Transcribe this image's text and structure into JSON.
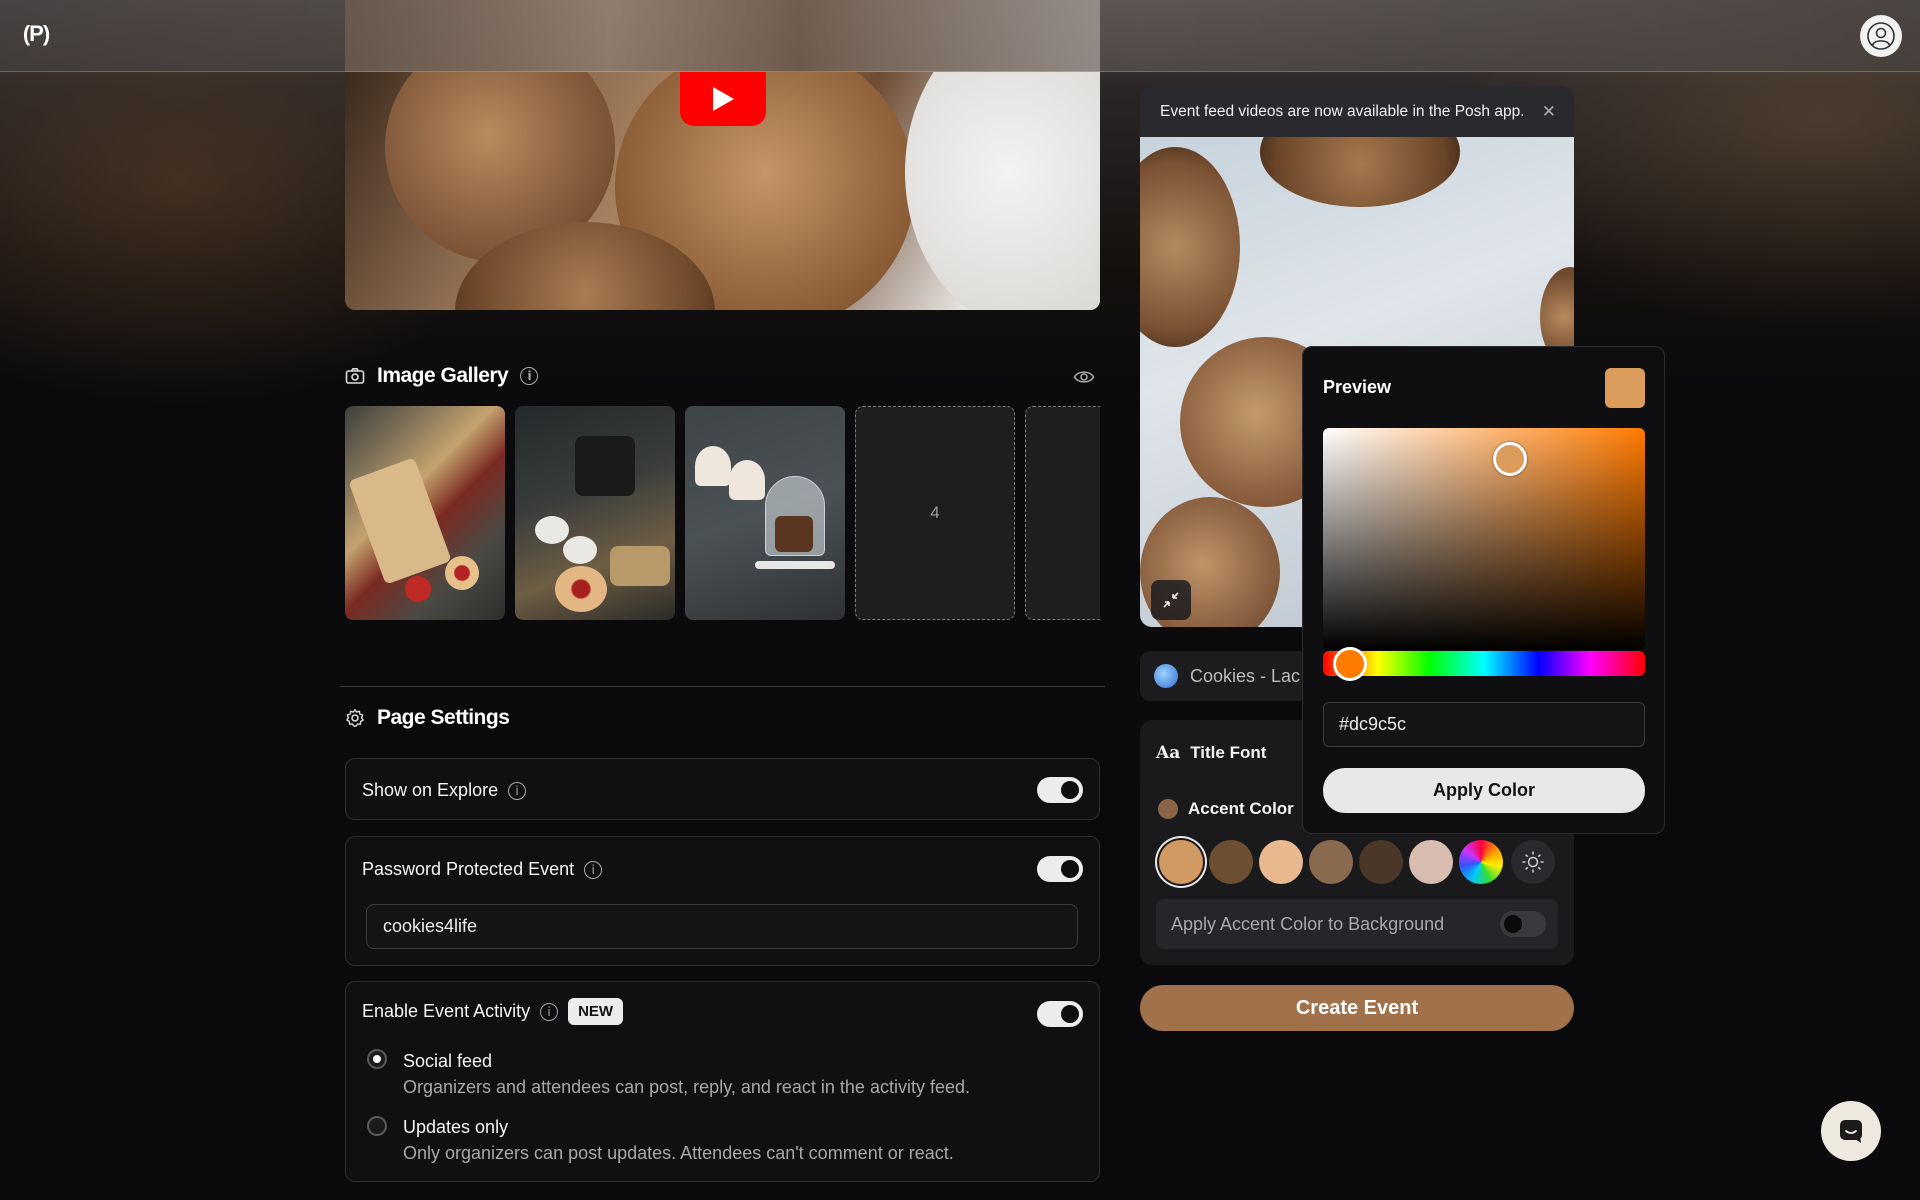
{
  "app": {
    "logo_text": "(P)"
  },
  "image_gallery": {
    "title": "Image Gallery",
    "empty_slot_label": "4"
  },
  "page_settings": {
    "title": "Page Settings",
    "show_on_explore": {
      "label": "Show on Explore",
      "enabled": true
    },
    "password_protected": {
      "label": "Password Protected Event",
      "enabled": true,
      "password_value": "cookies4life"
    },
    "event_activity": {
      "label": "Enable Event Activity",
      "badge": "NEW",
      "enabled": true,
      "options": [
        {
          "title": "Social feed",
          "description": "Organizers and attendees can post, reply, and react in the activity feed.",
          "selected": true
        },
        {
          "title": "Updates only",
          "description": "Only organizers can post updates. Attendees can't comment or react.",
          "selected": false
        }
      ]
    }
  },
  "preview_panel": {
    "banner_text": "Event feed videos are now available in the Posh app.",
    "event_chip_text": "Cookies - Lac",
    "title_font_label": "Title Font",
    "title_font_icon_text": "Aa",
    "accent_color_label": "Accent Color",
    "accent_swatches": [
      "#d09a62",
      "#6b4f30",
      "#e8b98f",
      "#8a6a4f",
      "#4a3728",
      "#d8bcb0"
    ],
    "selected_swatch_index": 0,
    "apply_accent_bg_label": "Apply Accent Color to Background",
    "apply_accent_bg_enabled": false,
    "create_button": "Create Event"
  },
  "color_picker": {
    "title": "Preview",
    "hex_value": "#dc9c5c",
    "apply_button": "Apply Color",
    "hue_degrees": 30,
    "saturation": 0.58,
    "brightness": 0.86
  },
  "colors": {
    "accent": "#dc9c5c",
    "create_button": "#a0714a",
    "youtube_red": "#ff0000"
  }
}
